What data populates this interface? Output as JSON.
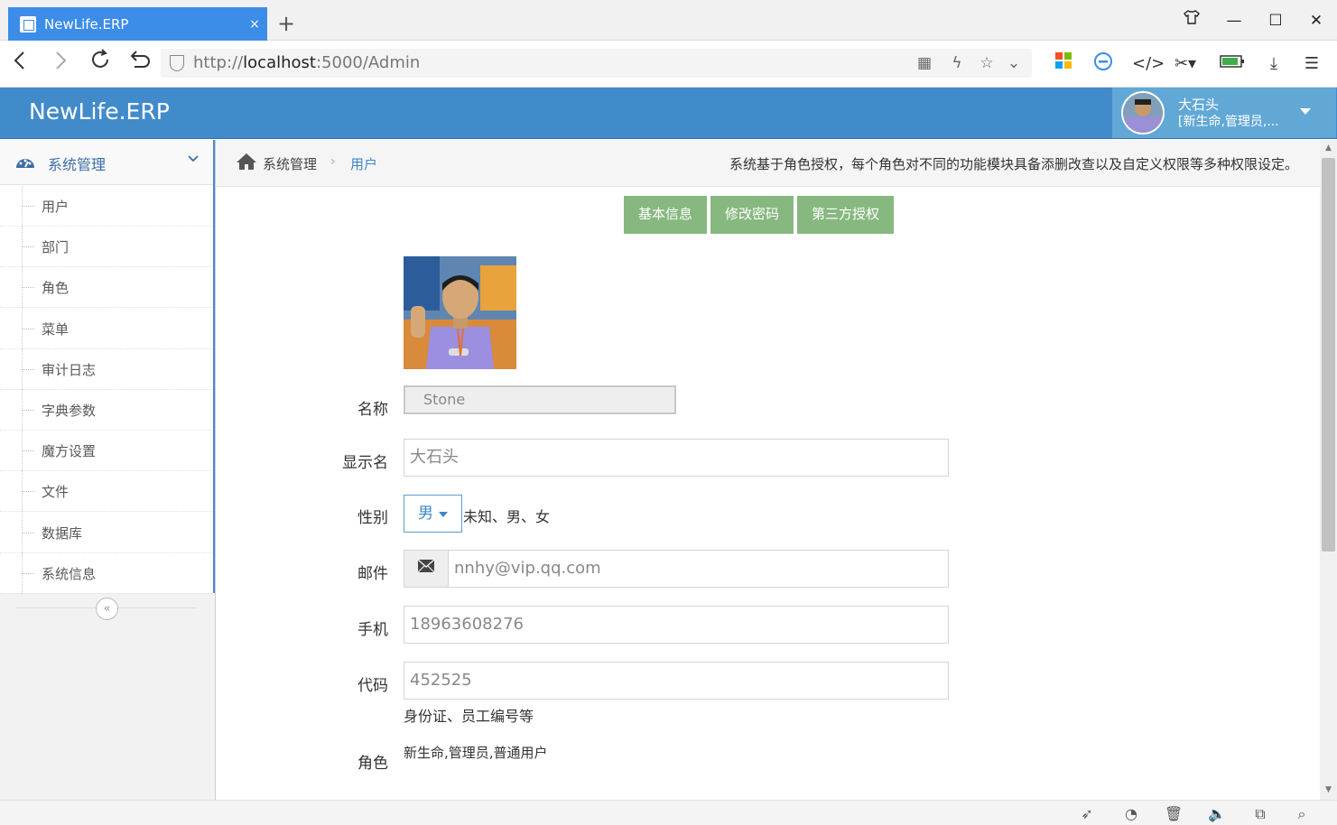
{
  "browser": {
    "tab_title": "NewLife.ERP",
    "tab_close": "×",
    "new_tab": "+",
    "url_prefix": "http://",
    "url_host": "localhost",
    "url_rest": ":5000/Admin"
  },
  "app": {
    "brand": "NewLife.ERP",
    "user_name": "大石头",
    "user_roles": "[新生命,管理员,..."
  },
  "sidebar": {
    "section_title": "系统管理",
    "items": [
      {
        "label": "用户"
      },
      {
        "label": "部门"
      },
      {
        "label": "角色"
      },
      {
        "label": "菜单"
      },
      {
        "label": "审计日志"
      },
      {
        "label": "字典参数"
      },
      {
        "label": "魔方设置"
      },
      {
        "label": "文件"
      },
      {
        "label": "数据库"
      },
      {
        "label": "系统信息"
      }
    ],
    "collapse_glyph": "«"
  },
  "breadcrumb": {
    "system": "系统管理",
    "separator": "›",
    "current": "用户",
    "note": "系统基于角色授权，每个角色对不同的功能模块具备添删改查以及自定义权限等多种权限设定。"
  },
  "tabs": [
    {
      "label": "基本信息"
    },
    {
      "label": "修改密码"
    },
    {
      "label": "第三方授权"
    }
  ],
  "form": {
    "name_label": "名称",
    "name_value": "Stone",
    "display_label": "显示名",
    "display_value": "大石头",
    "gender_label": "性别",
    "gender_value": "男",
    "gender_hint": "未知、男、女",
    "email_label": "邮件",
    "email_value": "nnhy@vip.qq.com",
    "phone_label": "手机",
    "phone_value": "18963608276",
    "code_label": "代码",
    "code_value": "452525",
    "code_hint": "身份证、员工编号等",
    "roles_label": "角色",
    "roles_value": "新生命,管理员,普通用户"
  },
  "colors": {
    "header": "#428bca",
    "tab_button": "#87b87f",
    "browser_tab": "#3c8de8"
  }
}
